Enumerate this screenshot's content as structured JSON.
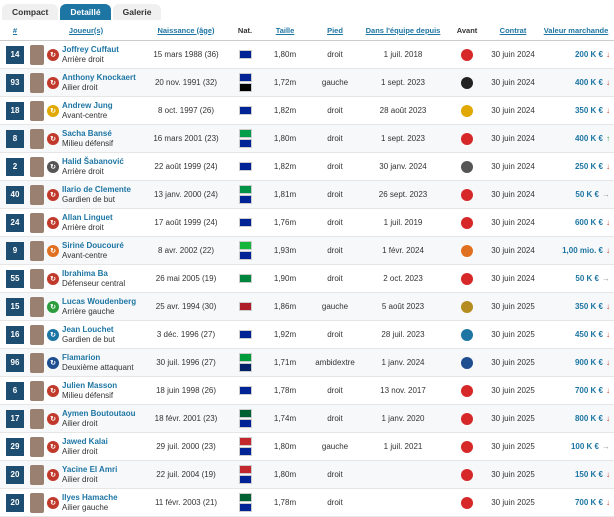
{
  "tabs": [
    {
      "label": "Compact",
      "active": false
    },
    {
      "label": "Detaillé",
      "active": true
    },
    {
      "label": "Galerie",
      "active": false
    }
  ],
  "columns": [
    "#",
    "Joueur(s)",
    "Naissance (âge)",
    "Nat.",
    "Taille",
    "Pied",
    "Dans l'équipe depuis",
    "Avant",
    "Contrat",
    "Valeur marchande"
  ],
  "colors": {
    "accent": "#1d75a3",
    "number_bg": "#1d4e72",
    "up": "#2d9c3c",
    "down": "#c0392b"
  },
  "players": [
    {
      "num": "14",
      "name": "Joffrey Cuffaut",
      "pos": "Arrière droit",
      "birth": "15 mars 1988 (36)",
      "flags": [
        "#002395"
      ],
      "height": "1,80m",
      "foot": "droit",
      "since": "1 juil. 2018",
      "club_color": "#d62828",
      "contract": "30 juin 2024",
      "value": "200 K €",
      "trend": "down",
      "badge_color": "#c0392b"
    },
    {
      "num": "93",
      "name": "Anthony Knockaert",
      "pos": "Ailier droit",
      "birth": "20 nov. 1991 (32)",
      "flags": [
        "#002395",
        "#000000"
      ],
      "height": "1,72m",
      "foot": "gauche",
      "since": "1 sept. 2023",
      "club_color": "#222222",
      "contract": "30 juin 2024",
      "value": "400 K €",
      "trend": "down",
      "badge_color": "#c0392b"
    },
    {
      "num": "18",
      "name": "Andrew Jung",
      "pos": "Avant-centre",
      "birth": "8 oct. 1997 (26)",
      "flags": [
        "#002395"
      ],
      "height": "1,82m",
      "foot": "droit",
      "since": "28 août 2023",
      "club_color": "#e0a800",
      "contract": "30 juin 2024",
      "value": "350 K €",
      "trend": "down",
      "badge_color": "#e0a800"
    },
    {
      "num": "8",
      "name": "Sacha Bansé",
      "pos": "Milieu défensif",
      "birth": "16 mars 2001 (23)",
      "flags": [
        "#009e49",
        "#002395"
      ],
      "height": "1,80m",
      "foot": "droit",
      "since": "1 sept. 2023",
      "club_color": "#d62828",
      "contract": "30 juin 2024",
      "value": "400 K €",
      "trend": "up",
      "badge_color": "#c0392b"
    },
    {
      "num": "2",
      "name": "Halid Šabanović",
      "pos": "Arrière droit",
      "birth": "22 août 1999 (24)",
      "flags": [
        "#002395"
      ],
      "height": "1,82m",
      "foot": "droit",
      "since": "30 janv. 2024",
      "club_color": "#555555",
      "contract": "30 juin 2024",
      "value": "250 K €",
      "trend": "down",
      "badge_color": "#555555"
    },
    {
      "num": "40",
      "name": "Ilario de Clemente",
      "pos": "Gardien de but",
      "birth": "13 janv. 2000 (24)",
      "flags": [
        "#009246",
        "#002395"
      ],
      "height": "1,81m",
      "foot": "droit",
      "since": "26 sept. 2023",
      "club_color": "#d62828",
      "contract": "30 juin 2024",
      "value": "50 K €",
      "trend": "flat",
      "badge_color": "#c0392b"
    },
    {
      "num": "24",
      "name": "Allan Linguet",
      "pos": "Arrière droit",
      "birth": "17 août 1999 (24)",
      "flags": [
        "#002395"
      ],
      "height": "1,76m",
      "foot": "droit",
      "since": "1 juil. 2019",
      "club_color": "#d62828",
      "contract": "30 juin 2024",
      "value": "600 K €",
      "trend": "down",
      "badge_color": "#c0392b"
    },
    {
      "num": "9",
      "name": "Siriné Doucouré",
      "pos": "Avant-centre",
      "birth": "8 avr. 2002 (22)",
      "flags": [
        "#14b53a",
        "#002395"
      ],
      "height": "1,93m",
      "foot": "droit",
      "since": "1 févr. 2024",
      "club_color": "#e07020",
      "contract": "30 juin 2024",
      "value": "1,00 mio. €",
      "trend": "down",
      "badge_color": "#e07020"
    },
    {
      "num": "55",
      "name": "Ibrahima Ba",
      "pos": "Défenseur central",
      "birth": "26 mai 2005 (19)",
      "flags": [
        "#00853f"
      ],
      "height": "1,90m",
      "foot": "droit",
      "since": "2 oct. 2023",
      "club_color": "#d62828",
      "contract": "30 juin 2024",
      "value": "50 K €",
      "trend": "flat",
      "badge_color": "#c0392b"
    },
    {
      "num": "15",
      "name": "Lucas Woudenberg",
      "pos": "Arrière gauche",
      "birth": "25 avr. 1994 (30)",
      "flags": [
        "#ae1c28"
      ],
      "height": "1,86m",
      "foot": "gauche",
      "since": "5 août 2023",
      "club_color": "#b58c20",
      "contract": "30 juin 2025",
      "value": "350 K €",
      "trend": "down",
      "badge_color": "#2d9c3c"
    },
    {
      "num": "16",
      "name": "Jean Louchet",
      "pos": "Gardien de but",
      "birth": "3 déc. 1996 (27)",
      "flags": [
        "#002395"
      ],
      "height": "1,92m",
      "foot": "droit",
      "since": "28 juil. 2023",
      "club_color": "#1d75a3",
      "contract": "30 juin 2025",
      "value": "450 K €",
      "trend": "down",
      "badge_color": "#1d75a3"
    },
    {
      "num": "96",
      "name": "Flamarion",
      "pos": "Deuxième attaquant",
      "birth": "30 juil. 1996 (27)",
      "flags": [
        "#009c3b",
        "#012169"
      ],
      "height": "1,71m",
      "foot": "ambidextre",
      "since": "1 janv. 2024",
      "club_color": "#1d4e8f",
      "contract": "30 juin 2025",
      "value": "900 K €",
      "trend": "down",
      "badge_color": "#1d4e8f"
    },
    {
      "num": "6",
      "name": "Julien Masson",
      "pos": "Milieu défensif",
      "birth": "18 juin 1998 (26)",
      "flags": [
        "#002395"
      ],
      "height": "1,78m",
      "foot": "droit",
      "since": "13 nov. 2017",
      "club_color": "#d62828",
      "contract": "30 juin 2025",
      "value": "700 K €",
      "trend": "down",
      "badge_color": "#c0392b"
    },
    {
      "num": "17",
      "name": "Aymen Boutoutaou",
      "pos": "Ailier droit",
      "birth": "18 févr. 2001 (23)",
      "flags": [
        "#006233",
        "#002395"
      ],
      "height": "1,74m",
      "foot": "droit",
      "since": "1 janv. 2020",
      "club_color": "#d62828",
      "contract": "30 juin 2025",
      "value": "800 K €",
      "trend": "down",
      "badge_color": "#c0392b"
    },
    {
      "num": "29",
      "name": "Jawed Kalai",
      "pos": "Ailier droit",
      "birth": "29 juil. 2000 (23)",
      "flags": [
        "#c1272d",
        "#002395"
      ],
      "height": "1,80m",
      "foot": "gauche",
      "since": "1 juil. 2021",
      "club_color": "#d62828",
      "contract": "30 juin 2025",
      "value": "100 K €",
      "trend": "flat",
      "badge_color": "#c0392b"
    },
    {
      "num": "20",
      "name": "Yacine El Amri",
      "pos": "Ailier droit",
      "birth": "22 juil. 2004 (19)",
      "flags": [
        "#c1272d",
        "#002395"
      ],
      "height": "1,80m",
      "foot": "droit",
      "since": "",
      "club_color": "#d62828",
      "contract": "30 juin 2025",
      "value": "150 K €",
      "trend": "down",
      "badge_color": "#c0392b"
    },
    {
      "num": "20",
      "name": "Ilyes Hamache",
      "pos": "Ailier gauche",
      "birth": "11 févr. 2003 (21)",
      "flags": [
        "#006233",
        "#002395"
      ],
      "height": "1,78m",
      "foot": "droit",
      "since": "",
      "club_color": "#d62828",
      "contract": "30 juin 2025",
      "value": "700 K €",
      "trend": "down",
      "badge_color": "#c0392b"
    }
  ]
}
